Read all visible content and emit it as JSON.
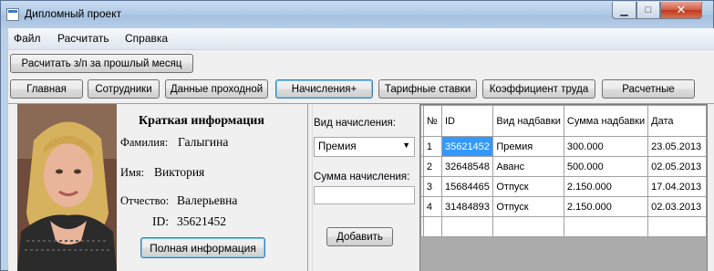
{
  "window": {
    "title": "Дипломный проект",
    "minimize_glyph": "▁",
    "maximize_glyph": "□",
    "close_glyph": "✕"
  },
  "menu": [
    "Файл",
    "Расчитать",
    "Справка"
  ],
  "toolbar": {
    "prev_month_button": "Расчитать з/п за прошлый месяц"
  },
  "nav_buttons": [
    "Главная",
    "Сотрудники",
    "Данные проходной",
    "Начисления+",
    "Тарифные ставки",
    "Коэффициент труда",
    "Расчетные"
  ],
  "active_nav": "Начисления+",
  "employee": {
    "section_title": "Краткая информация",
    "surname_label": "Фамилия:",
    "surname": "Галыгина",
    "name_label": "Имя:",
    "name": "Виктория",
    "patronymic_label": "Отчество:",
    "patronymic": "Валерьевна",
    "id_label": "ID:",
    "id": "35621452",
    "full_info_button": "Полная информация"
  },
  "accrual_form": {
    "type_label": "Вид начисления:",
    "type_value": "Премия",
    "amount_label": "Сумма начисления:",
    "amount_value": "",
    "add_button": "Добавить"
  },
  "table": {
    "columns": [
      "№",
      "ID",
      "Вид надбавки",
      "Сумма надбавки",
      "Дата"
    ],
    "rows": [
      [
        "1",
        "35621452",
        "Премия",
        "300.000",
        "23.05.2013"
      ],
      [
        "2",
        "32648548",
        "Аванс",
        "500.000",
        "02.05.2013"
      ],
      [
        "3",
        "15684465",
        "Отпуск",
        "2.150.000",
        "17.04.2013"
      ],
      [
        "4",
        "31484893",
        "Отпуск",
        "2.150.000",
        "02.03.2013"
      ]
    ],
    "selected_cell": "35621452"
  },
  "colors": {
    "selection": "#3399ff",
    "active_border": "#3c7fb1",
    "close_button": "#c0391f"
  }
}
